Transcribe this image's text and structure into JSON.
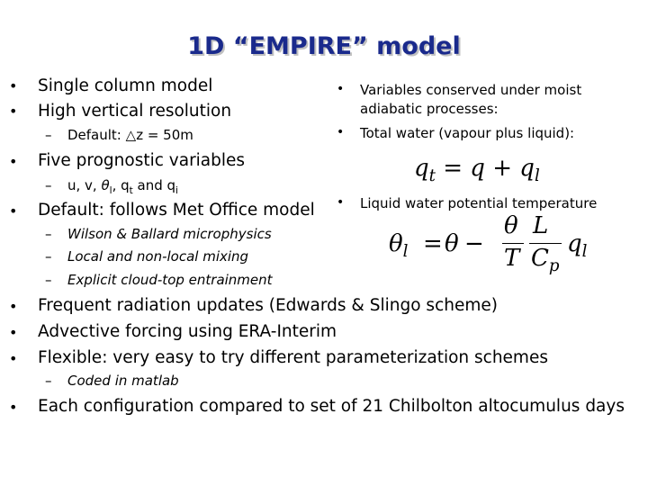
{
  "title": "1D “EMPIRE” model",
  "left": {
    "b1": "Single column model",
    "b2": "High vertical resolution",
    "s1_prefix": "Default: ",
    "s1_delta": "△",
    "s1_rest": "z = 50m",
    "b3": "Five prognostic variables",
    "s2_prefix": "u, v, ",
    "s2_theta": "θ",
    "s2_theta_sub": "l",
    "s2_mid": ", q",
    "s2_q_sub": "t",
    "s2_and": " and q",
    "s2_qi_sub": "i",
    "b4": "Default: follows Met Office model",
    "s3": "Wilson & Ballard microphysics",
    "s4": "Local and non-local mixing",
    "s5": "Explicit cloud-top entrainment"
  },
  "right": {
    "r1_line1": "Variables conserved under moist",
    "r1_line2": "adiabatic processes:",
    "r2": "Total water (vapour plus liquid):",
    "eq1": {
      "lhs": "q",
      "lhs_sub": "t",
      "rhs1": "q",
      "plus": "+",
      "rhs2": "q",
      "rhs2_sub": "l",
      "eq": "="
    },
    "r3": "Liquid water potential temperature",
    "eq2": {
      "lhs": "θ",
      "lhs_sub": "l",
      "eq": "=",
      "theta": "θ",
      "minus": "−",
      "num1": "θ",
      "den1": "T",
      "num2": "L",
      "den2": "C",
      "den2_sub": "p",
      "q": "q",
      "q_sub": "l"
    }
  },
  "bottom": {
    "b5": "Frequent radiation updates (Edwards & Slingo scheme)",
    "b6": "Advective forcing using ERA-Interim",
    "b7": "Flexible: very easy to try different parameterization schemes",
    "s6": "Coded in matlab",
    "b8": "Each configuration compared to set of 21 Chilbolton altocumulus days"
  },
  "glyphs": {
    "bullet": "•",
    "dash": "–"
  }
}
